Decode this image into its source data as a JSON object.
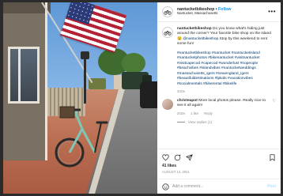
{
  "post": {
    "username": "nantucketbikeshop",
    "follow_label": "Follow",
    "separator": " • ",
    "location": "Nantucket, Massachusetts",
    "more_icon": "more-horizontal-icon"
  },
  "caption": {
    "username": "nantucketbikeshop",
    "text": " Do you know what's hiding just around the corner? Your favorite bike shop on the island 😉 ",
    "mention": "@nantucketbikeshop",
    "text2": " Stop by this weekend to rent some fun!",
    "hashtags": "#nantucketbikeshop #nantucket #nantucketisland #nantucketphotos #bikenantucket #visitnantucket #visitcapecod #capecod #wonderlust #nopeople #beachvibes #islandvibes #nantucketweddings #massachusetts_igers #newengland_igers #beautifuldestinations #lpkids #vacationvibes #socialmentals #bikerental #bikelife",
    "time": "202w"
  },
  "comment": {
    "username": "christeapot",
    "text": " More local photos please. Really nice to see it all again!",
    "time": "202w",
    "likes": "1 like",
    "reply": "Reply",
    "view_replies": "View replies (1)"
  },
  "actions": {
    "icons": [
      "heart-icon",
      "comment-icon",
      "share-icon",
      "bookmark-icon"
    ],
    "likes": "41 likes",
    "date": "August 13, 2021"
  },
  "add_comment": {
    "placeholder": "Add a comment...",
    "post_label": "Post"
  },
  "colors": {
    "link": "#0095f6",
    "hashtag": "#00376b",
    "muted": "#8e8e8e",
    "post_disabled": "#b2dffc"
  }
}
